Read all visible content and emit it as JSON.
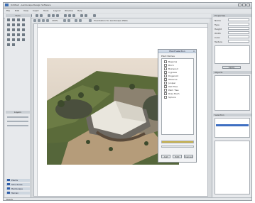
{
  "window": {
    "title": "Untitled - Landscape Design Software"
  },
  "menu": [
    "File",
    "Edit",
    "View",
    "Insert",
    "Tools",
    "Layout",
    "Window",
    "Help"
  ],
  "toolbar2": {
    "zoom_value": "100%",
    "option_label": "Foundation for Landscape Walls"
  },
  "left_panel": {
    "section1_title": "Tools",
    "section2_title": "Layers",
    "tabs": [
      "Plants",
      "Structures",
      "Hardscape",
      "Terrain"
    ]
  },
  "dialog": {
    "title": "Plant Selection",
    "list_label": "Plant Names",
    "items": [
      "Begonia",
      "Birch",
      "Boxwood",
      "Cypress",
      "Dogwood",
      "Hibiscus",
      "Juniper",
      "Oak Tree",
      "Palm Tree",
      "Rose Bush",
      "Spruce"
    ],
    "progress_percent": 100,
    "buttons": [
      "Add",
      "Edit",
      "Cancel"
    ]
  },
  "right_panel": {
    "header": "Properties",
    "fields": [
      {
        "label": "Name",
        "value": ""
      },
      {
        "label": "Type",
        "value": ""
      },
      {
        "label": "Height",
        "value": ""
      },
      {
        "label": "Width",
        "value": ""
      },
      {
        "label": "Color",
        "value": ""
      },
      {
        "label": "Texture",
        "value": ""
      }
    ],
    "section2": "Objects",
    "section3": "Selection",
    "apply_label": "Apply"
  },
  "status": {
    "text": "Ready"
  },
  "colors": {
    "grass": "#5b6b3a",
    "patio": "#b59c7a",
    "roof": "#e9e6dd",
    "selection": "#3f6fc2"
  }
}
